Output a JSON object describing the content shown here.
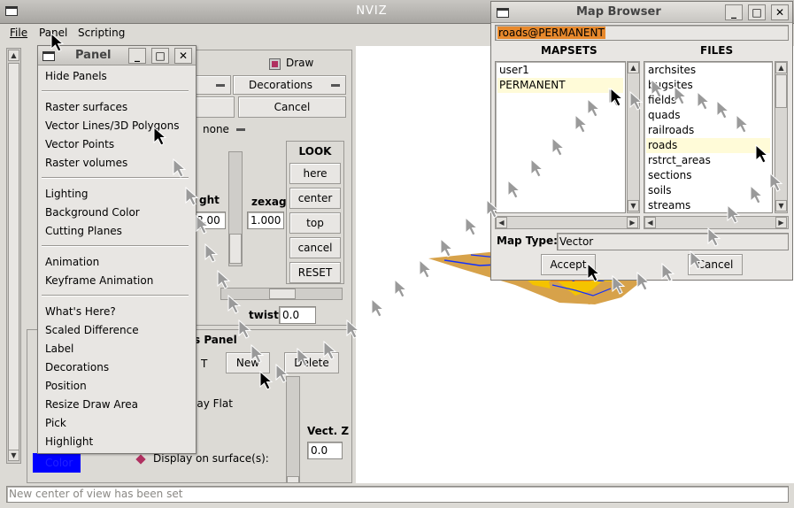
{
  "nviz": {
    "title": "NVIZ",
    "menubar": {
      "file": "File",
      "panel": "Panel",
      "scripting": "Scripting"
    },
    "status": "New center of view has been set"
  },
  "panel_menu": {
    "title": "Panel",
    "items": [
      "Hide Panels"
    ],
    "surfaces": [
      "Raster surfaces",
      "Vector Lines/3D Polygons",
      "Vector Points",
      "Raster volumes"
    ],
    "appearance": [
      "Lighting",
      "Background Color",
      "Cutting Planes"
    ],
    "animation": [
      "Animation",
      "Keyframe Animation"
    ],
    "tools": [
      "What's Here?",
      "Scaled Difference",
      "Label",
      "Decorations",
      "Position",
      "Resize Draw Area",
      "Pick",
      "Highlight"
    ]
  },
  "view_panel": {
    "draw_label": "Draw",
    "decorations_label": "Decorations",
    "cancel_label": "Cancel",
    "none_label": "none",
    "height_partial": "ght",
    "height_value": "8.00",
    "zexag_label": "zexag",
    "zexag_value": "1.000",
    "look": {
      "title": "LOOK",
      "here": "here",
      "center": "center",
      "top": "top",
      "cancel": "cancel",
      "reset": "RESET"
    },
    "twist_label": "twist",
    "twist_value": "0.0"
  },
  "vector_panel": {
    "title_partial": "s Panel",
    "current_partial": "T",
    "new_label": "New",
    "delete_label": "Delete",
    "display_flat_partial": "lay Flat",
    "color_label": "Color",
    "color_value": "#0000ff",
    "display_on_surface": "Display on surface(s):",
    "vectz_label": "Vect. Z",
    "vectz_value": "0.0"
  },
  "map_browser": {
    "title": "Map Browser",
    "selected_map": "roads@PERMANENT",
    "mapsets_header": "MAPSETS",
    "files_header": "FILES",
    "mapsets": [
      "user1",
      "PERMANENT"
    ],
    "files": [
      "archsites",
      "bugsites",
      "fields",
      "quads",
      "railroads",
      "roads",
      "rstrct_areas",
      "sections",
      "soils",
      "streams"
    ],
    "map_type_label": "Map Type:",
    "map_type_value": "Vector",
    "accept_label": "Accept",
    "cancel_label": "Cancel"
  },
  "colors": {
    "highlight": "#fffbd8",
    "selection": "#e8892c",
    "terrain": "#d7a24a"
  }
}
